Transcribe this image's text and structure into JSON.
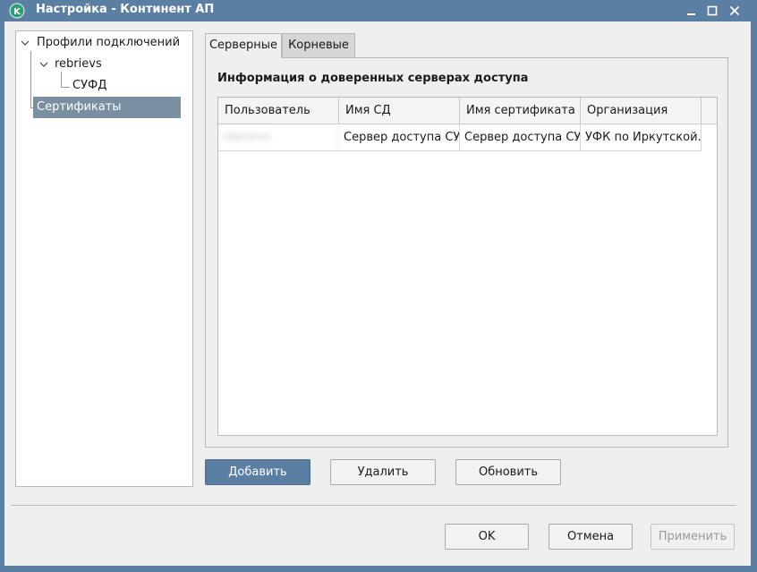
{
  "window": {
    "title": "Настройка - Континент АП",
    "app_icon_letter": "K",
    "colors": {
      "titlebar": "#5b7fa3",
      "accent": "#5b7fa3",
      "selection": "#7b8fa2"
    }
  },
  "tree": {
    "items": [
      {
        "label": "Профили подключений",
        "expanded": true
      },
      {
        "label": "rebrievs",
        "expanded": true
      },
      {
        "label": "СУФД"
      },
      {
        "label": "Сертификаты",
        "selected": true
      }
    ]
  },
  "tabs": [
    {
      "label": "Серверные",
      "active": true
    },
    {
      "label": "Корневые",
      "active": false
    }
  ],
  "panel": {
    "title": "Информация о доверенных серверах доступа",
    "columns": [
      "Пользователь",
      "Имя СД",
      "Имя сертификата",
      "Организация"
    ],
    "rows": [
      [
        "rebrievs",
        "Сервер доступа СУ...",
        "Сервер доступа СУ...",
        "УФК по Иркутской..."
      ]
    ]
  },
  "actions": {
    "add": "Добавить",
    "delete": "Удалить",
    "refresh": "Обновить"
  },
  "dialog": {
    "ok": "OK",
    "cancel": "Отмена",
    "apply": "Применить"
  }
}
